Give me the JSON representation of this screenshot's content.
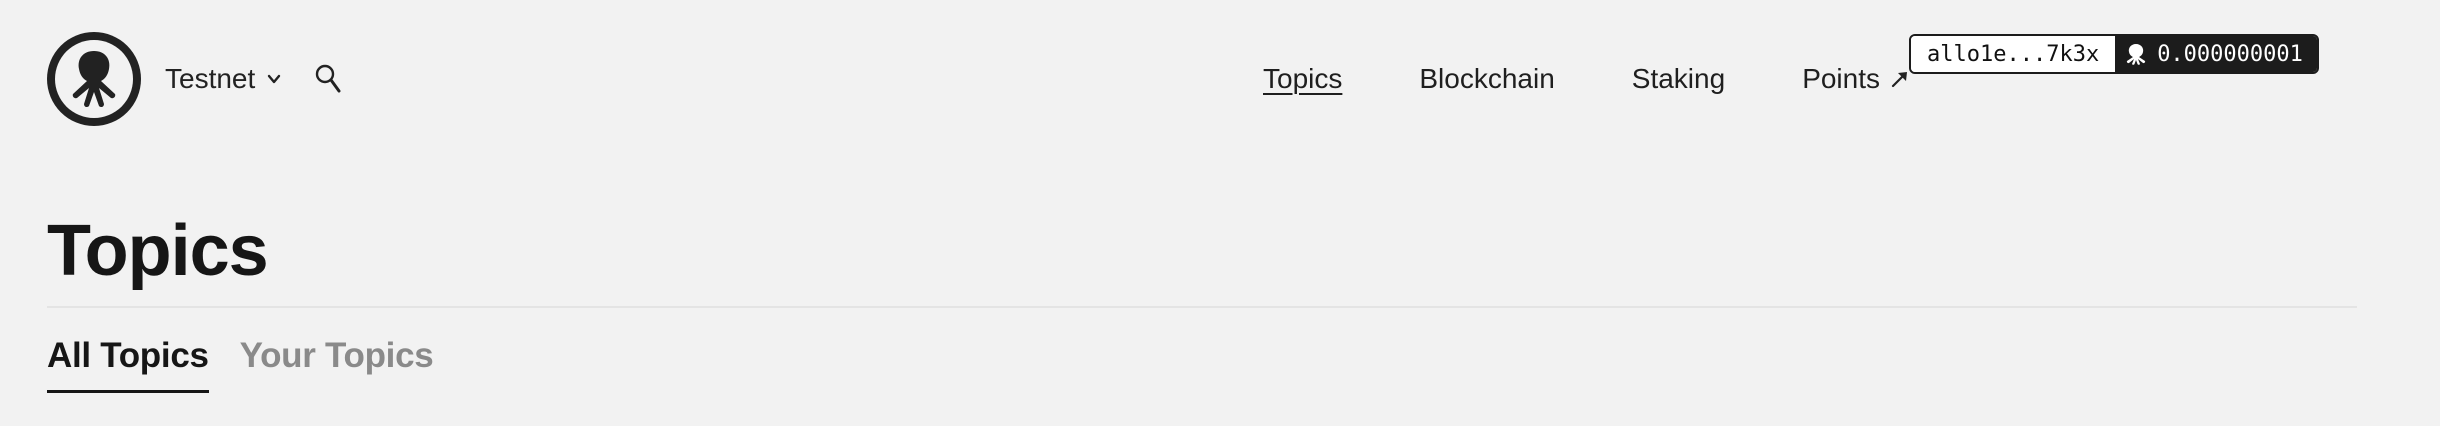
{
  "header": {
    "network_label": "Testnet",
    "nav": [
      {
        "label": "Topics",
        "active": true
      },
      {
        "label": "Blockchain",
        "active": false
      },
      {
        "label": "Staking",
        "active": false
      },
      {
        "label": "Points",
        "active": false,
        "external": true
      }
    ],
    "wallet": {
      "address": "allo1e...7k3x",
      "balance": "0.000000001"
    },
    "icons": {
      "logo": "allora-logo-icon",
      "network_chevron": "chevron-down-icon",
      "search": "search-icon",
      "points_external": "arrow-up-right-icon",
      "balance_token": "allora-token-icon"
    }
  },
  "main": {
    "title": "Topics",
    "tabs": [
      {
        "label": "All Topics",
        "active": true
      },
      {
        "label": "Your Topics",
        "active": false
      }
    ]
  },
  "colors": {
    "background": "#f2f2f2",
    "text": "#1c1c1c",
    "inactive_tab": "#8a8a8a",
    "wallet_dark": "#1c1c1c"
  }
}
